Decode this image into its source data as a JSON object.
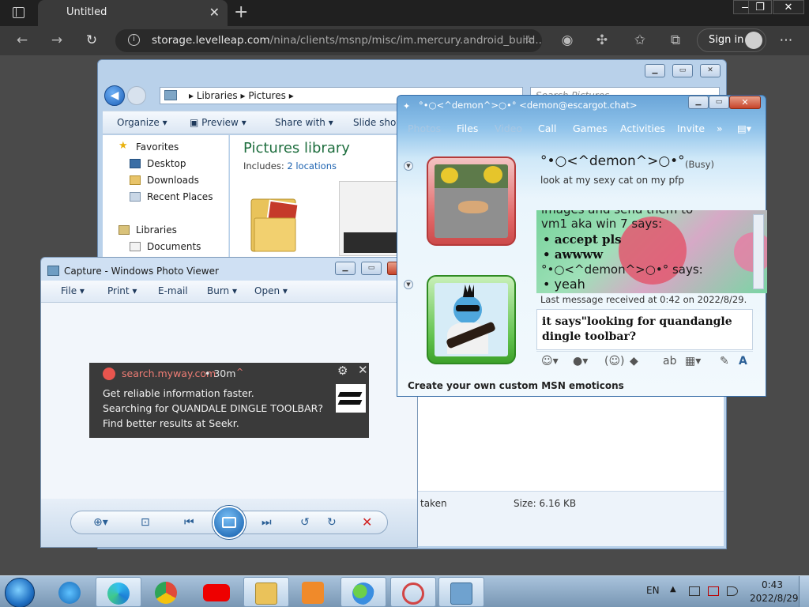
{
  "browser": {
    "tab_title": "Untitled",
    "url_host": "storage.levelleap.com",
    "url_path": "/nina/clients/msnp/misc/im.mercury.android_build...",
    "sign_in_label": "Sign in"
  },
  "explorer": {
    "breadcrumb": [
      "Libraries",
      "Pictures"
    ],
    "search_placeholder": "Search Pictures",
    "commands": [
      "Organize",
      "Preview",
      "Share with",
      "Slide show"
    ],
    "nav": {
      "favorites_label": "Favorites",
      "favorites": [
        "Desktop",
        "Downloads",
        "Recent Places"
      ],
      "libraries_label": "Libraries",
      "libraries": [
        "Documents"
      ]
    },
    "library_title": "Pictures library",
    "includes_label": "Includes:",
    "includes_link": "2 locations",
    "details_taken": "taken",
    "details_size": "Size: 6.16 KB"
  },
  "photo_viewer": {
    "title": "Capture - Windows Photo Viewer",
    "menus": [
      "File",
      "Print",
      "E-mail",
      "Burn",
      "Open"
    ]
  },
  "toast": {
    "source": "search.myway.com",
    "time": "• 30m",
    "line1": "Get reliable information faster.",
    "line2": "Searching for QUANDALE DINGLE TOOLBAR?",
    "line3": "Find better results at Seekr."
  },
  "msn": {
    "title": "°•○<^demon^>○•° <demon@escargot.chat>",
    "menu": [
      {
        "label": "Photos",
        "dim": true
      },
      {
        "label": "Files",
        "dim": false
      },
      {
        "label": "Video",
        "dim": true
      },
      {
        "label": "Call",
        "dim": false
      },
      {
        "label": "Games",
        "dim": false
      },
      {
        "label": "Activities",
        "dim": false
      },
      {
        "label": "Invite",
        "dim": false
      }
    ],
    "contact_name": "°•○<^demon^>○•°",
    "contact_status": "(Busy)",
    "contact_psm": "look at my sexy cat on my pfp",
    "conversation": {
      "partial_top": "images and send them to",
      "speaker1": "vm1 aka win 7 says:",
      "msg1": "accept pls",
      "msg2": "awwww",
      "speaker2": "°•○<^demon^>○•° says:",
      "msg3": "yeah"
    },
    "last_message": "Last message received at 0:42 on 2022/8/29.",
    "input_text": "it says\"looking for quandangle dingle toolbar?",
    "footer": "Create your own custom MSN emoticons"
  },
  "taskbar": {
    "language": "EN",
    "time": "0:43",
    "date": "2022/8/29"
  },
  "colors": {
    "edge_dark": "#202020",
    "win7_glass": "#b9d1ea",
    "msn_blue": "#6aa5d8",
    "library_title": "#1e6e3e",
    "toast_source": "#ef7d75"
  }
}
